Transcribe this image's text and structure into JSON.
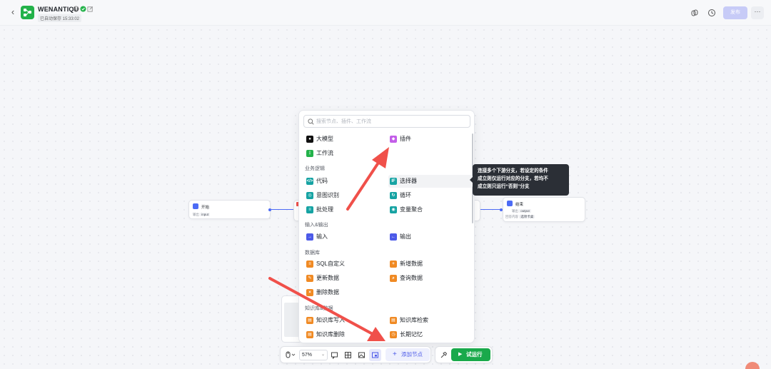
{
  "header": {
    "app_name": "WENANTIQU",
    "save_status": "已自动保存 15:33:02",
    "publish_label": "发布",
    "more_label": "···"
  },
  "nodes": {
    "start": {
      "title": "开始",
      "row_label": "输出",
      "row_value": "input"
    },
    "end": {
      "title": "结束",
      "row1_label": "输出",
      "row1_value": "output",
      "row2_label": "回答内容",
      "row2_value": "选项卡桌"
    }
  },
  "popup": {
    "search_placeholder": "搜索节点、插件、工作流",
    "top_items": [
      {
        "label": "大模型",
        "icon": "llm-icon",
        "color": "#111111"
      },
      {
        "label": "插件",
        "icon": "plugin-icon",
        "color": "#c35ee8"
      },
      {
        "label": "工作流",
        "icon": "workflow-icon",
        "color": "#23b24a"
      }
    ],
    "groups": [
      {
        "title": "业务逻辑",
        "items": [
          {
            "label": "代码",
            "icon": "code-icon",
            "color": "#16a3a3"
          },
          {
            "label": "选择器",
            "icon": "condition-icon",
            "color": "#16a3a3",
            "highlighted": true
          },
          {
            "label": "意图识别",
            "icon": "intent-icon",
            "color": "#16a3a3"
          },
          {
            "label": "循环",
            "icon": "loop-icon",
            "color": "#16a3a3"
          },
          {
            "label": "批处理",
            "icon": "batch-icon",
            "color": "#16a3a3"
          },
          {
            "label": "变量聚合",
            "icon": "variable-merge-icon",
            "color": "#16a3a3"
          }
        ]
      },
      {
        "title": "输入&输出",
        "items": [
          {
            "label": "输入",
            "icon": "input-icon",
            "color": "#4c5ae8"
          },
          {
            "label": "输出",
            "icon": "output-icon",
            "color": "#4c5ae8"
          }
        ]
      },
      {
        "title": "数据库",
        "items": [
          {
            "label": "SQL自定义",
            "icon": "sql-icon",
            "color": "#f08a24"
          },
          {
            "label": "新增数据",
            "icon": "db-add-icon",
            "color": "#f08a24"
          },
          {
            "label": "更新数据",
            "icon": "db-update-icon",
            "color": "#f08a24"
          },
          {
            "label": "查询数据",
            "icon": "db-query-icon",
            "color": "#f08a24"
          },
          {
            "label": "删除数据",
            "icon": "db-delete-icon",
            "color": "#f08a24"
          }
        ]
      },
      {
        "title": "知识库&数据",
        "items": [
          {
            "label": "知识库写入",
            "icon": "kb-write-icon",
            "color": "#f08a24"
          },
          {
            "label": "知识库检索",
            "icon": "kb-search-icon",
            "color": "#f08a24"
          },
          {
            "label": "知识库删除",
            "icon": "kb-delete-icon",
            "color": "#f08a24"
          },
          {
            "label": "长期记忆",
            "icon": "memory-icon",
            "color": "#f08a24"
          }
        ]
      }
    ]
  },
  "tooltip": {
    "line1": "连接多个下游分支，若设定的条件",
    "line2": "成立则仅运行对应的分支，若均不",
    "line3": "成立则只运行“否则”分支"
  },
  "toolbar": {
    "zoom": "57%",
    "add_node_label": "添加节点",
    "run_label": "试运行"
  },
  "colors": {
    "accent": "#4c5ae8",
    "run_green": "#19a94b",
    "arrow_red": "#f0504a"
  }
}
